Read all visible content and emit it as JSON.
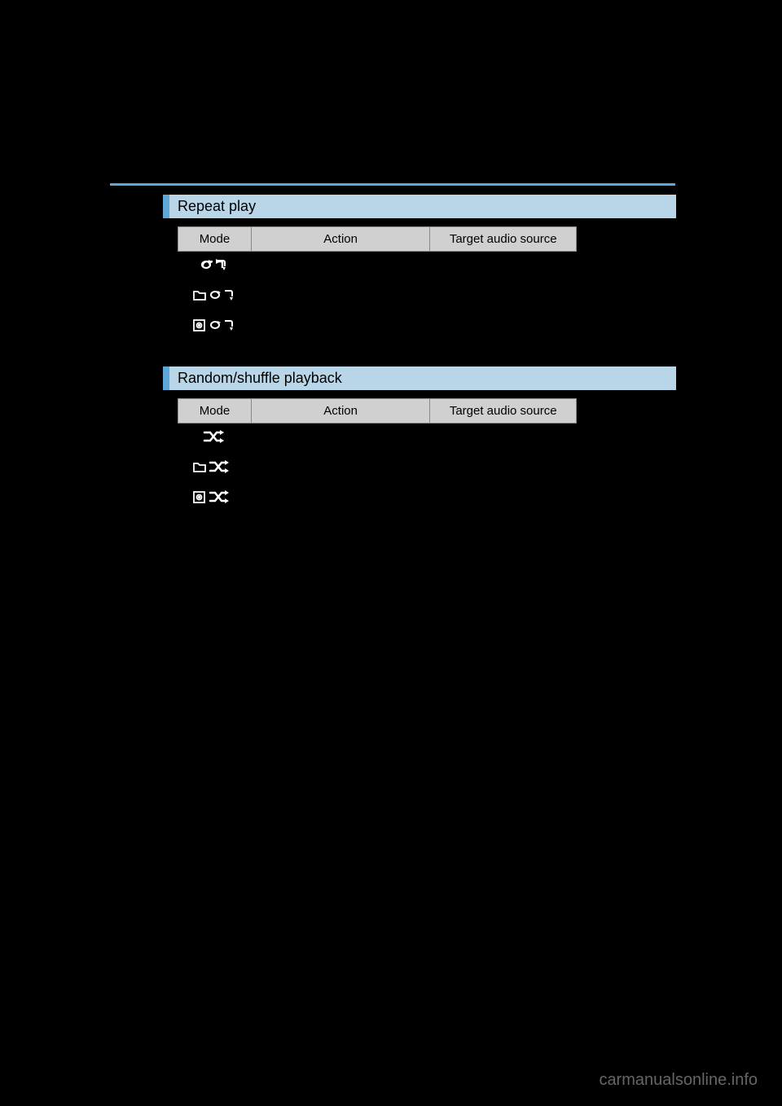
{
  "sections": [
    {
      "title": "Repeat play",
      "headers": {
        "mode": "Mode",
        "action": "Action",
        "target": "Target audio source"
      },
      "rows": [
        {
          "icon": "repeat-track"
        },
        {
          "icon": "repeat-folder"
        },
        {
          "icon": "repeat-album"
        }
      ]
    },
    {
      "title": "Random/shuffle playback",
      "headers": {
        "mode": "Mode",
        "action": "Action",
        "target": "Target audio source"
      },
      "rows": [
        {
          "icon": "shuffle"
        },
        {
          "icon": "shuffle-folder"
        },
        {
          "icon": "shuffle-album"
        }
      ]
    }
  ],
  "watermark": "carmanualsonline.info"
}
